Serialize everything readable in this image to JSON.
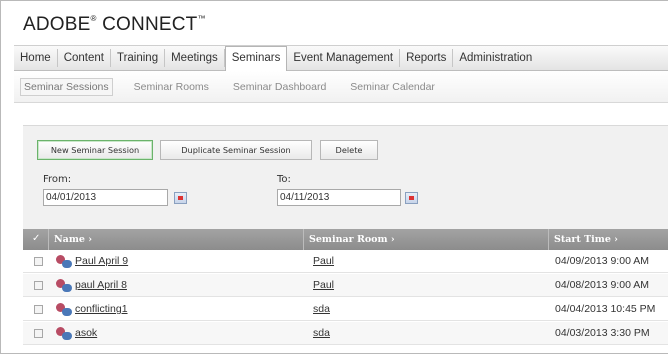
{
  "app": {
    "brand": "ADOBE",
    "brand_reg": "®",
    "brand_suffix": " CONNECT",
    "brand_tm": "™"
  },
  "main_nav": [
    "Home",
    "Content",
    "Training",
    "Meetings",
    "Seminars",
    "Event Management",
    "Reports",
    "Administration"
  ],
  "main_nav_active": "Seminars",
  "sub_nav": [
    "Seminar Sessions",
    "Seminar Rooms",
    "Seminar Dashboard",
    "Seminar Calendar"
  ],
  "sub_nav_active": "Seminar Sessions",
  "toolbar": {
    "new_label": "New Seminar Session",
    "duplicate_label": "Duplicate Seminar Session",
    "delete_label": "Delete"
  },
  "filters": {
    "from_label": "From:",
    "from_value": "04/01/2013",
    "to_label": "To:",
    "to_value": "04/11/2013"
  },
  "table": {
    "check_header": "✓",
    "columns": [
      "Name ›",
      "Seminar Room ›",
      "Start Time ›"
    ],
    "rows": [
      {
        "name": "Paul April 9",
        "room": "Paul",
        "start": "04/09/2013 9:00 AM"
      },
      {
        "name": "paul April 8",
        "room": "Paul",
        "start": "04/08/2013 9:00 AM"
      },
      {
        "name": "conflicting1",
        "room": "sda",
        "start": "04/04/2013 10:45 PM"
      },
      {
        "name": "asok",
        "room": "sda",
        "start": "04/03/2013 3:30 PM"
      }
    ]
  },
  "icons": {
    "calendar": "calendar-icon",
    "session": "seminar-session-icon"
  },
  "colors": {
    "active_button_border": "#6bb36b",
    "grid_header": "#999999",
    "session_icon_red": "#b84c64",
    "session_icon_blue": "#4a78b8"
  }
}
